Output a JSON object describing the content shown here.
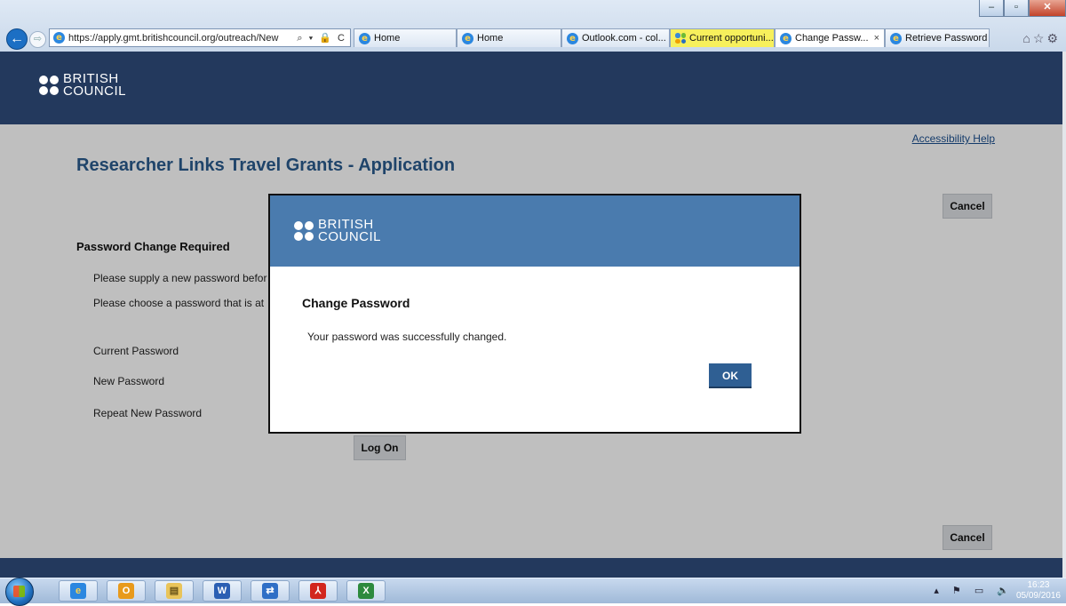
{
  "browser": {
    "url": "https://apply.gmt.britishcouncil.org/outreach/New",
    "address_tools": "⌕ ▾ 🔒 C",
    "tabs": [
      {
        "label": "Home",
        "icon": "ie-icon"
      },
      {
        "label": "Home",
        "icon": "ie-icon"
      },
      {
        "label": "Outlook.com - col...",
        "icon": "ie-icon"
      },
      {
        "label": "Current opportuni...",
        "icon": "grid-icon",
        "highlight": "#f7f05c"
      },
      {
        "label": "Change Passw...",
        "icon": "ie-icon",
        "active": true,
        "close": "×"
      },
      {
        "label": "Retrieve Password",
        "icon": "ie-icon"
      }
    ],
    "window_controls": {
      "minimize": "–",
      "restore": "▫",
      "close": "✕"
    }
  },
  "header": {
    "logo_line1": "BRITISH",
    "logo_line2": "COUNCIL"
  },
  "page": {
    "accessibility_help": "Accessibility Help",
    "title": "Researcher Links Travel Grants - Application",
    "cancel_label": "Cancel",
    "section_title": "Password Change Required",
    "instruction_1": "Please supply a new password befor",
    "instruction_2": "Please choose a password that is at",
    "current_password_label": "Current Password",
    "new_password_label": "New Password",
    "repeat_password_label": "Repeat New Password",
    "logon_label": "Log On"
  },
  "modal": {
    "logo_line1": "BRITISH",
    "logo_line2": "COUNCIL",
    "title": "Change Password",
    "message": "Your password was successfully changed.",
    "ok_label": "OK"
  },
  "colors": {
    "header_bg": "#23395d",
    "modal_header_bg": "#4a7bae",
    "title_blue": "#2a5b8e",
    "ok_bg": "#2f5f93"
  },
  "taskbar": {
    "apps": [
      "internet-explorer-icon",
      "outlook-icon",
      "file-explorer-icon",
      "word-icon",
      "link-app-icon",
      "acrobat-icon",
      "excel-icon"
    ],
    "time": "16:23",
    "date": "05/09/2016"
  }
}
